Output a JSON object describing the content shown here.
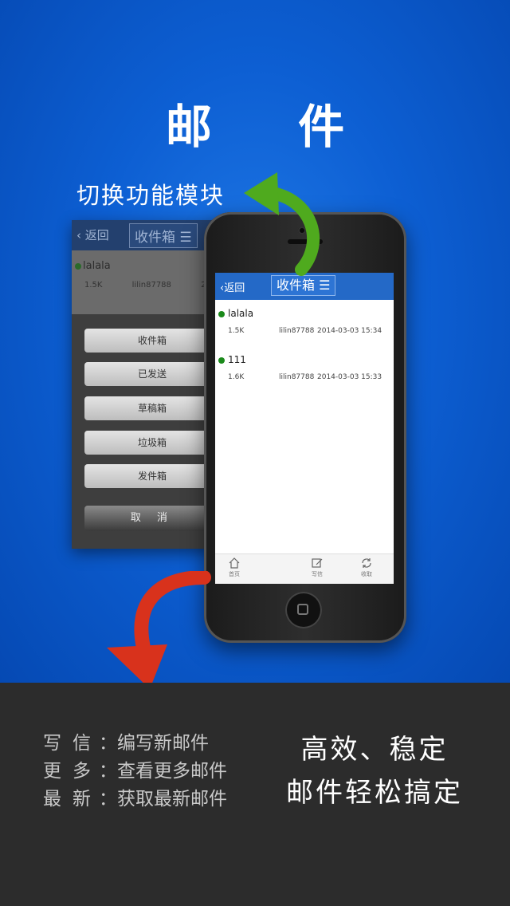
{
  "hero": {
    "title": "邮 件",
    "switch_label": "切换功能模块"
  },
  "back_screen": {
    "back_label": "返回",
    "title": "收件箱 ☰",
    "row_subject": "lalala",
    "row_meta": "1.5K lilin87788 2014-0",
    "menu": [
      "收件箱",
      "已发送",
      "草稿箱",
      "垃圾箱",
      "发件箱"
    ],
    "cancel_label": "取 消"
  },
  "phone_screen": {
    "back_label": "返回",
    "title": "收件箱 ☰",
    "mails": [
      {
        "subject": "lalala",
        "size": "1.5K",
        "sender": "lilin87788",
        "time": "2014-03-03 15:34"
      },
      {
        "subject": "111",
        "size": "1.6K",
        "sender": "lilin87788",
        "time": "2014-03-03 15:33"
      }
    ],
    "tabs": [
      {
        "icon": "home-icon",
        "label": "首页"
      },
      {
        "icon": "compose-icon",
        "label": "写信"
      },
      {
        "icon": "refresh-icon",
        "label": "收取"
      }
    ]
  },
  "features": [
    {
      "key": "写信",
      "desc": "：编写新邮件"
    },
    {
      "key": "更多",
      "desc": "：查看更多邮件"
    },
    {
      "key": "最新",
      "desc": "：获取最新邮件"
    }
  ],
  "slogan": {
    "line1": "高效、稳定",
    "line2": "邮件轻松搞定"
  },
  "colors": {
    "hero_blue": "#0d5fd3",
    "header_blue": "#2469c7",
    "green_arrow": "#4faa1e",
    "red_arrow": "#d8321c",
    "bottom_dark": "#2c2c2c"
  }
}
